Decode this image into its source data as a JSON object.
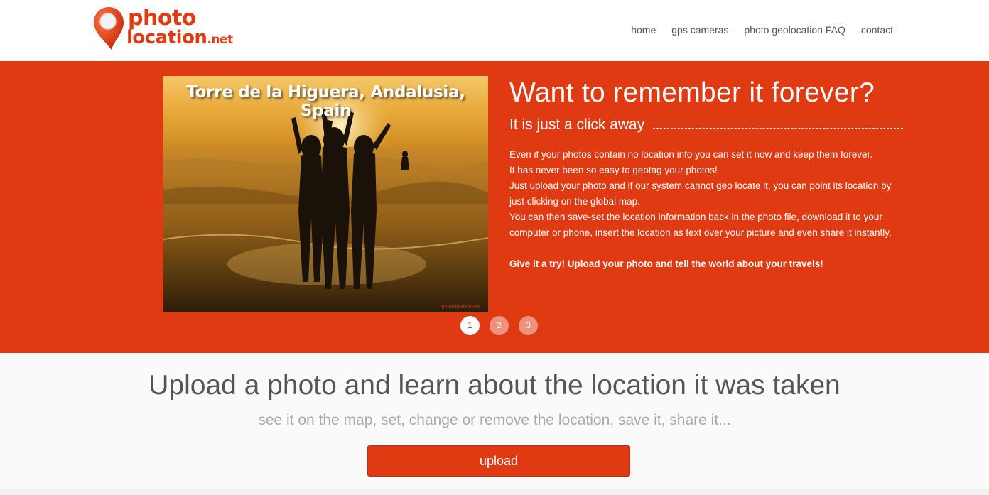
{
  "header": {
    "logo": {
      "word1": "photo",
      "word2": "location",
      "word3": ".net"
    },
    "nav": [
      {
        "label": "home"
      },
      {
        "label": "gps cameras"
      },
      {
        "label": "photo geolocation FAQ"
      },
      {
        "label": "contact"
      }
    ]
  },
  "hero": {
    "photo_caption": "Torre de la Higuera, Andalusia, Spain",
    "title": "Want to remember it forever?",
    "subtitle": "It is just a click away",
    "body": [
      "Even if your photos contain no location info you can set it now and keep them forever.",
      "It has never been so easy to geotag your photos!",
      "Just upload your photo and if our system cannot geo locate it, you can point its location by just clicking on the global map.",
      "You can then save-set the location information back in the photo file, download it to your computer or phone, insert the location as text over your picture and even share it instantly."
    ],
    "cta": "Give it a try! Upload your photo and tell the world about your travels!",
    "slides": [
      {
        "label": "1",
        "active": true
      },
      {
        "label": "2",
        "active": false
      },
      {
        "label": "3",
        "active": false
      }
    ]
  },
  "upload": {
    "title": "Upload a photo and learn about the location it was taken",
    "subtitle": "see it on the map, set, change or remove the location, save it, share it...",
    "button_label": "upload"
  },
  "colors": {
    "accent": "#e03a12",
    "nav_text": "#555555",
    "subtitle_text": "#aaaaaa"
  }
}
